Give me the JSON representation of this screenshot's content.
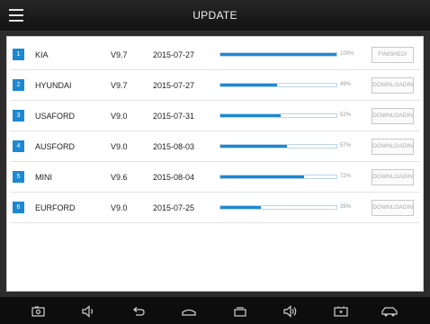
{
  "header": {
    "title": "UPDATE",
    "menu_icon": "hamburger-icon"
  },
  "theme": {
    "accent": "#1e88d0",
    "header_bg": "#1a1a1a",
    "panel_bg": "#ffffff"
  },
  "updates": [
    {
      "index": "1",
      "brand": "KIA",
      "version": "V9.7",
      "date": "2015-07-27",
      "progress": 100,
      "percent_label": "100%",
      "button_label": "FINISHED!"
    },
    {
      "index": "2",
      "brand": "HYUNDAI",
      "version": "V9.7",
      "date": "2015-07-27",
      "progress": 49,
      "percent_label": "49%",
      "button_label": "DOWNLOADIN"
    },
    {
      "index": "3",
      "brand": "USAFORD",
      "version": "V9.0",
      "date": "2015-07-31",
      "progress": 52,
      "percent_label": "52%",
      "button_label": "DOWNLOADIN"
    },
    {
      "index": "4",
      "brand": "AUSFORD",
      "version": "V9.0",
      "date": "2015-08-03",
      "progress": 57,
      "percent_label": "57%",
      "button_label": "DOWNLOADIN"
    },
    {
      "index": "5",
      "brand": "MINI",
      "version": "V9.6",
      "date": "2015-08-04",
      "progress": 72,
      "percent_label": "72%",
      "button_label": "DOWNLOADIN"
    },
    {
      "index": "6",
      "brand": "EURFORD",
      "version": "V9.0",
      "date": "2015-07-25",
      "progress": 35,
      "percent_label": "35%",
      "button_label": "DOWNLOADIN"
    }
  ],
  "navbar": {
    "icons": [
      "screenshot-icon",
      "volume-down-icon",
      "back-icon",
      "home-icon",
      "recent-apps-icon",
      "volume-up-icon",
      "battery-icon",
      "vehicle-icon"
    ]
  }
}
